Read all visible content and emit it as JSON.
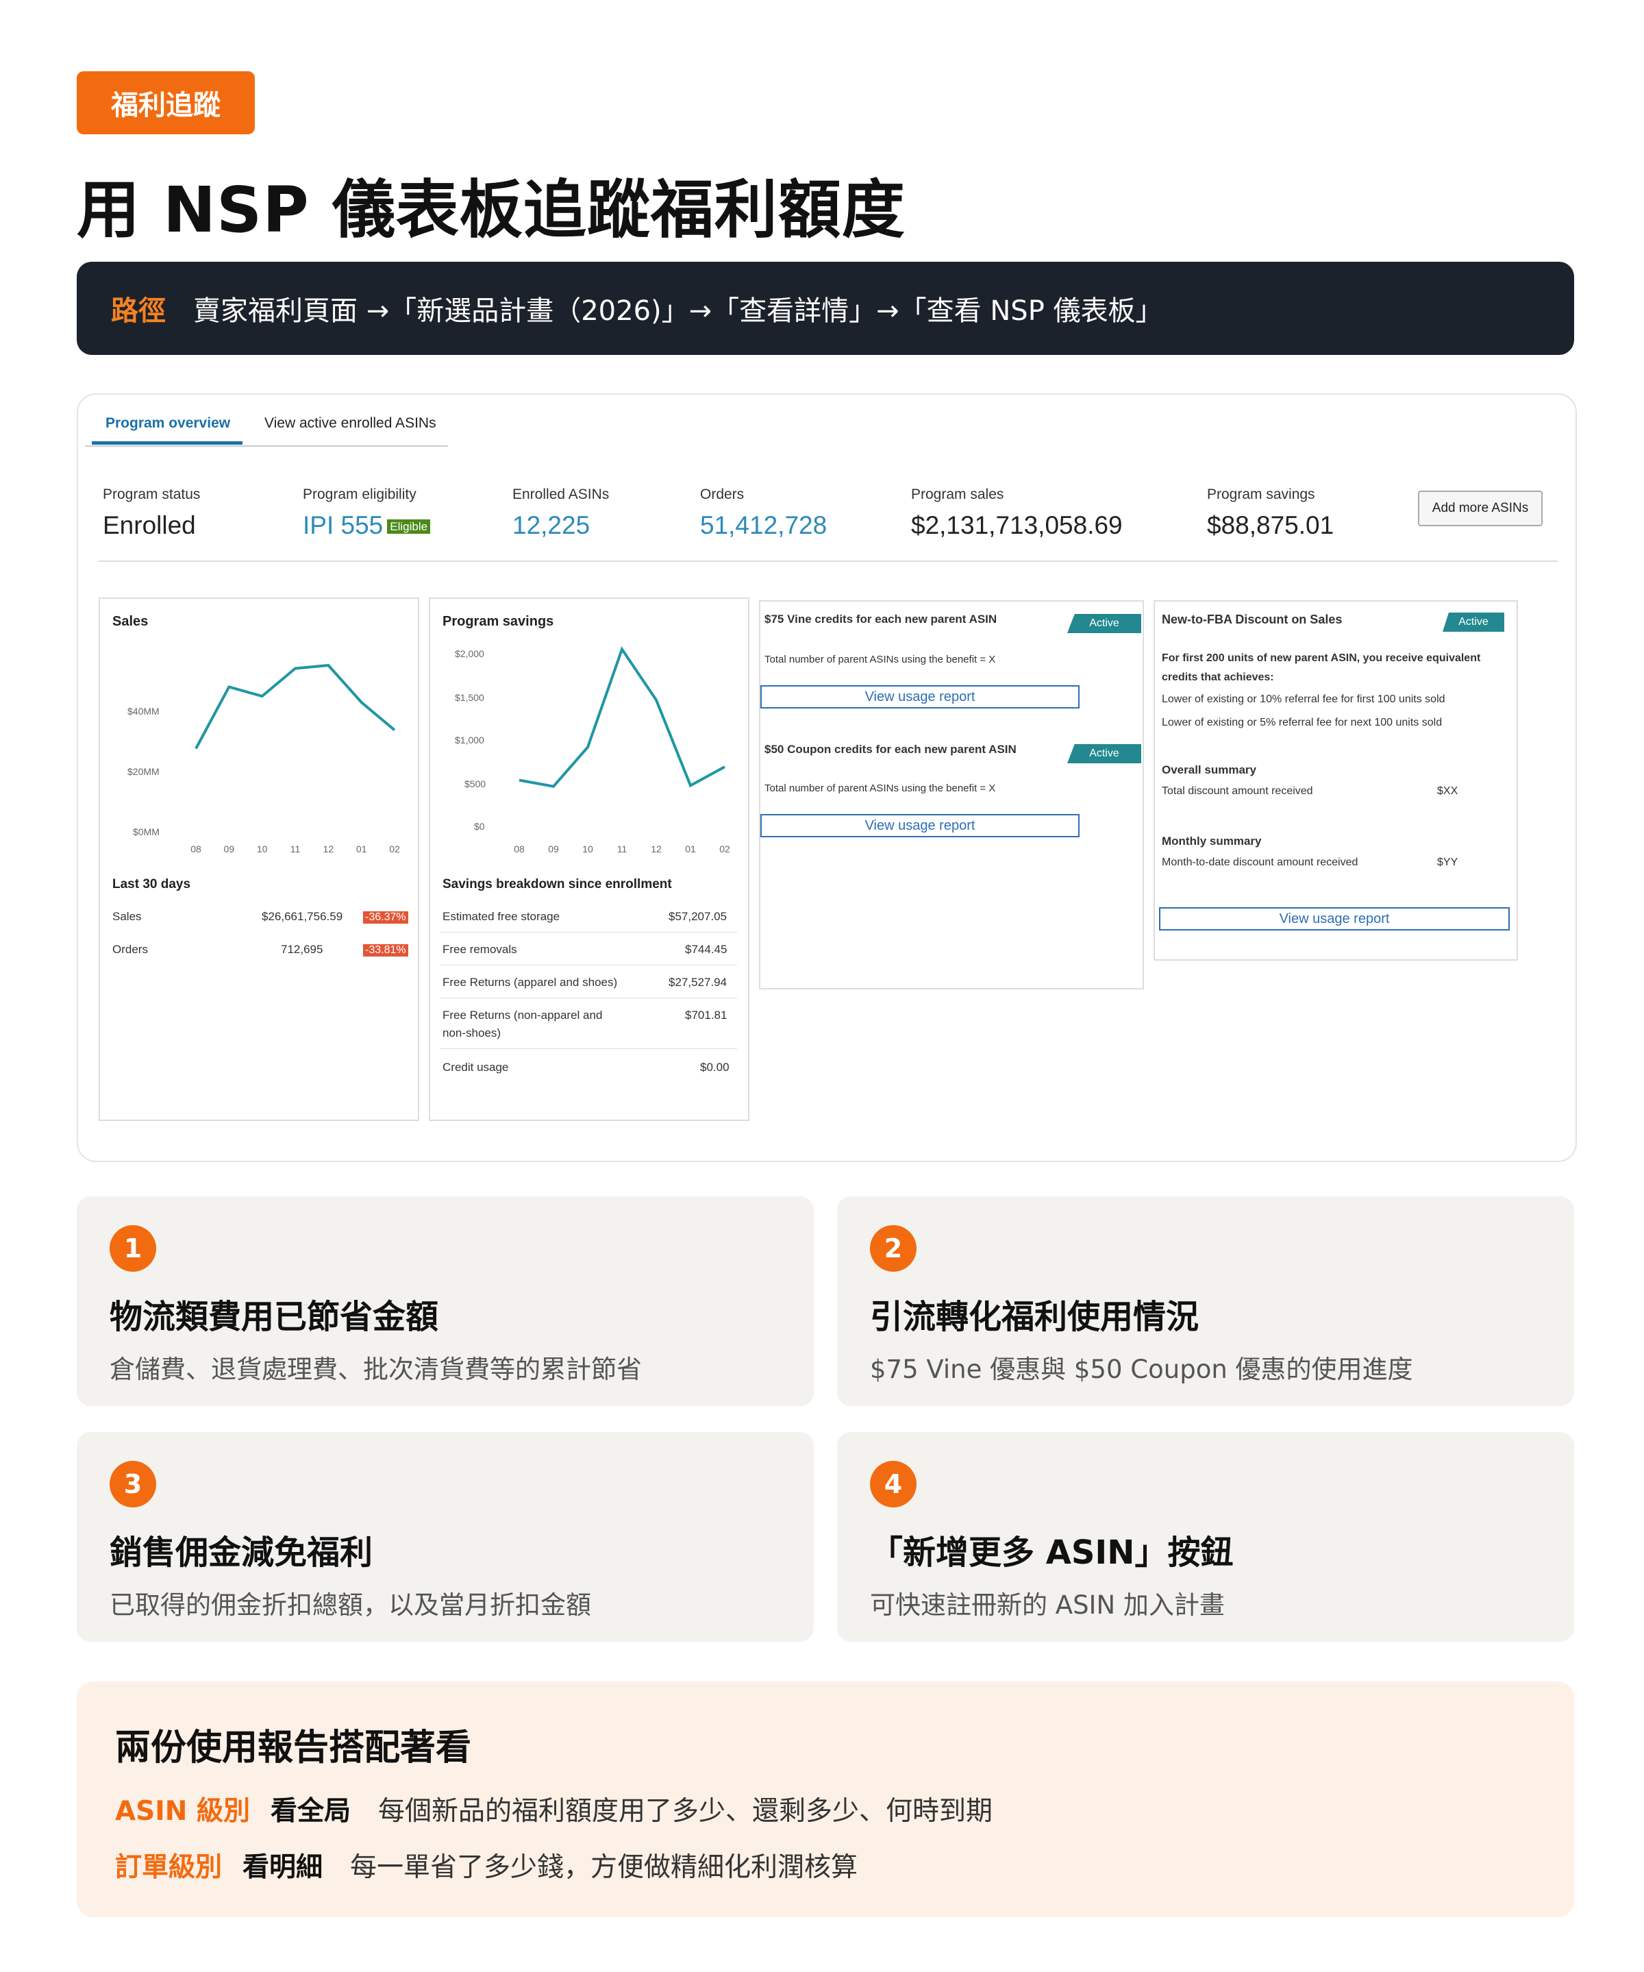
{
  "tag": "福利追蹤",
  "title": "用 NSP 儀表板追蹤福利額度",
  "path": {
    "label": "路徑",
    "text": "賣家福利頁面 →「新選品計畫（2026)」→「查看詳情」→「查看 NSP 儀表板」"
  },
  "dashboard": {
    "tabs": [
      "Program overview",
      "View active enrolled ASINs"
    ],
    "stats": [
      {
        "label": "Program status",
        "value": "Enrolled"
      },
      {
        "label": "Program eligibility",
        "value": "IPI 555",
        "badge": "Eligible"
      },
      {
        "label": "Enrolled ASINs",
        "value": "12,225"
      },
      {
        "label": "Orders",
        "value": "51,412,728"
      },
      {
        "label": "Program sales",
        "value": "$2,131,713,058.69"
      },
      {
        "label": "Program savings",
        "value": "$88,875.01"
      }
    ],
    "add_button": "Add more ASINs",
    "sales_card": {
      "title": "Sales",
      "y_ticks": [
        "$40MM",
        "$20MM",
        "$0MM"
      ],
      "x_ticks": [
        "08",
        "09",
        "10",
        "11",
        "12",
        "01",
        "02"
      ],
      "last30_title": "Last 30 days",
      "rows": [
        {
          "label": "Sales",
          "value": "$26,661,756.59",
          "change": "-36.37%"
        },
        {
          "label": "Orders",
          "value": "712,695",
          "change": "-33.81%"
        }
      ]
    },
    "savings_card": {
      "title": "Program savings",
      "y_ticks": [
        "$2,000",
        "$1,500",
        "$1,000",
        "$500",
        "$0"
      ],
      "x_ticks": [
        "08",
        "09",
        "10",
        "11",
        "12",
        "01",
        "02"
      ],
      "breakdown_title": "Savings breakdown since enrollment",
      "rows": [
        {
          "label": "Estimated free storage",
          "value": "$57,207.05"
        },
        {
          "label": "Free removals",
          "value": "$744.45"
        },
        {
          "label": "Free Returns (apparel and shoes)",
          "value": "$27,527.94"
        },
        {
          "label": "Free Returns (non-apparel and",
          "label2": "non-shoes)",
          "value": "$701.81"
        },
        {
          "label": "Credit usage",
          "value": "$0.00"
        }
      ]
    },
    "vine_card": {
      "vine_title": "$75 Vine credits for each new parent ASIN",
      "vine_text": "Total number of parent ASINs using the benefit = X",
      "coupon_title": "$50 Coupon credits for each new parent ASIN",
      "coupon_text": "Total number of parent ASINs using the benefit = X",
      "active": "Active",
      "view": "View usage report"
    },
    "fba_card": {
      "title": "New-to-FBA Discount on Sales",
      "active": "Active",
      "intro1": "For first 200 units of new parent ASIN, you receive equivalent",
      "intro2": "credits that achieves:",
      "line1": "Lower of existing or 10% referral fee for first 100 units sold",
      "line2": "Lower of existing or 5% referral fee for next 100 units sold",
      "overall_title": "Overall summary",
      "overall_label": "Total discount amount received",
      "overall_value": "$XX",
      "monthly_title": "Monthly summary",
      "monthly_label": "Month-to-date discount amount received",
      "monthly_value": "$YY",
      "view": "View usage report"
    }
  },
  "chart_data": [
    {
      "type": "line",
      "title": "Sales",
      "x": [
        "08",
        "09",
        "10",
        "11",
        "12",
        "01",
        "02"
      ],
      "y_ticks": [
        "$0MM",
        "$20MM",
        "$40MM"
      ],
      "values": [
        27,
        47,
        44,
        53,
        54,
        42,
        33
      ],
      "color": "#1f97a3"
    },
    {
      "type": "line",
      "title": "Program savings",
      "x": [
        "08",
        "09",
        "10",
        "11",
        "12",
        "01",
        "02"
      ],
      "ylim": [
        0,
        2000
      ],
      "values": [
        580,
        510,
        950,
        2050,
        1480,
        520,
        730
      ],
      "color": "#1f97a3"
    }
  ],
  "features": [
    {
      "num": "1",
      "title": "物流類費用已節省金額",
      "desc": "倉儲費、退貨處理費、批次清貨費等的累計節省"
    },
    {
      "num": "2",
      "title": "引流轉化福利使用情況",
      "desc": "$75 Vine 優惠與 $50 Coupon 優惠的使用進度"
    },
    {
      "num": "3",
      "title": "銷售佣金減免福利",
      "desc": "已取得的佣金折扣總額，以及當月折扣金額"
    },
    {
      "num": "4",
      "title": "「新增更多 ASIN」按鈕",
      "desc": "可快速註冊新的 ASIN 加入計畫"
    }
  ],
  "reports": {
    "title": "兩份使用報告搭配著看",
    "rows": [
      {
        "level": "ASIN 級別",
        "key": "看全局",
        "text": "每個新品的福利額度用了多少、還剩多少、何時到期"
      },
      {
        "level": "訂單級別",
        "key": "看明細",
        "text": "每一單省了多少錢，方便做精細化利潤核算"
      }
    ]
  },
  "colors": {
    "accent": "#f26b10",
    "dark": "#1c222b",
    "line": "#1f97a3",
    "link": "#2d8ab8"
  }
}
